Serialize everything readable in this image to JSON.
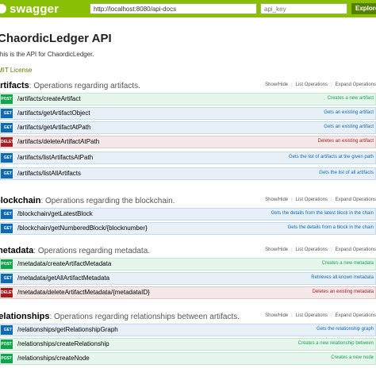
{
  "header": {
    "logo_text": "swagger",
    "url_value": "http://localhost:8080/api-docs",
    "api_key_placeholder": "api_key",
    "explore_label": "Explore"
  },
  "info": {
    "title": "ChaordicLedger API",
    "description": "This is the API for ChaordicLedger.",
    "license": "MIT License"
  },
  "resource_links": {
    "show_hide": "Show/Hide",
    "list_operations": "List Operations",
    "expand_operations": "Expand Operations"
  },
  "resources": [
    {
      "name": "artifacts",
      "description": ": Operations regarding artifacts.",
      "operations": [
        {
          "method": "POST",
          "path": "/artifacts/createArtifact",
          "summary": "Creates a new artifact"
        },
        {
          "method": "GET",
          "path": "/artifacts/getArtifactObject",
          "summary": "Gets an existing artifact"
        },
        {
          "method": "GET",
          "path": "/artifacts/getArtifactAtPath",
          "summary": "Gets an existing artifact"
        },
        {
          "method": "DELETE",
          "path": "/artifacts/deleteArtifactAtPath",
          "summary": "Deletes an existing artifact"
        },
        {
          "method": "GET",
          "path": "/artifacts/listArtifactsAtPath",
          "summary": "Gets the list of artifacts at the given path"
        },
        {
          "method": "GET",
          "path": "/artifacts/listAllArtifacts",
          "summary": "Gets the list of all artifacts"
        }
      ]
    },
    {
      "name": "blockchain",
      "description": ": Operations regarding the blockchain.",
      "operations": [
        {
          "method": "GET",
          "path": "/blockchain/getLatestBlock",
          "summary": "Gets the details from the latest block in the chain"
        },
        {
          "method": "GET",
          "path": "/blockchain/getNumberedBlock/{blocknumber}",
          "summary": "Gets the details from a block in the chain"
        }
      ]
    },
    {
      "name": "metadata",
      "description": ": Operations regarding metadata.",
      "operations": [
        {
          "method": "POST",
          "path": "/metadata/createArtifactMetadata",
          "summary": "Creates a new metadata"
        },
        {
          "method": "GET",
          "path": "/metadata/getAllArtifactMetadata",
          "summary": "Retrieves all known metadata"
        },
        {
          "method": "DELETE",
          "path": "/metadata/deleteArtifactMetadata/{metadataID}",
          "summary": "Deletes an existing metadata"
        }
      ]
    },
    {
      "name": "relationships",
      "description": ": Operations regarding relationships between artifacts.",
      "operations": [
        {
          "method": "GET",
          "path": "/relationships/getRelationshipGraph",
          "summary": "Gets the relationship graph"
        },
        {
          "method": "POST",
          "path": "/relationships/createRelationship",
          "summary": "Creates a new relationship between"
        },
        {
          "method": "POST",
          "path": "/relationships/createNode",
          "summary": "Creates a new node"
        }
      ]
    }
  ],
  "colors": {
    "header": "#89bf04",
    "post": "#10a54a",
    "get": "#0f6ab4",
    "delete": "#a41e22"
  }
}
